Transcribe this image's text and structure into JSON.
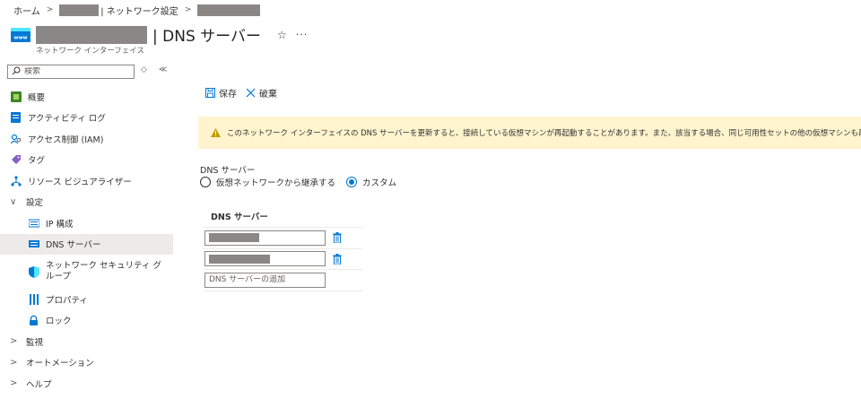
{
  "breadcrumb": {
    "home": "ホーム",
    "parent": "| ネットワーク設定"
  },
  "header": {
    "title": "| DNS サーバー",
    "subtitle": "ネットワーク インターフェイス",
    "star": "☆",
    "more": "···"
  },
  "search": {
    "placeholder": "検索"
  },
  "sidebar": {
    "collapse_icon": "≪",
    "items": [
      {
        "label": "概要",
        "icon": "overview-icon"
      },
      {
        "label": "アクティビティ ログ",
        "icon": "activity-log-icon"
      },
      {
        "label": "アクセス制御 (IAM)",
        "icon": "access-control-icon"
      },
      {
        "label": "タグ",
        "icon": "tag-icon"
      },
      {
        "label": "リソース ビジュアライザー",
        "icon": "resource-visualizer-icon"
      },
      {
        "label": "設定",
        "icon": "chevron-down-icon"
      },
      {
        "label": "IP 構成",
        "icon": "ip-config-icon"
      },
      {
        "label": "DNS サーバー",
        "icon": "dns-server-icon"
      },
      {
        "label": "ネットワーク セキュリティ グループ",
        "icon": "network-security-group-icon"
      },
      {
        "label": "プロパティ",
        "icon": "properties-icon"
      },
      {
        "label": "ロック",
        "icon": "lock-icon"
      },
      {
        "label": "監視",
        "icon": "chevron-right-icon"
      },
      {
        "label": "オートメーション",
        "icon": "chevron-right-icon"
      },
      {
        "label": "ヘルプ",
        "icon": "chevron-right-icon"
      }
    ]
  },
  "toolbar": {
    "save_label": "保存",
    "discard_label": "破棄"
  },
  "warning": {
    "text": "このネットワーク インターフェイスの DNS サーバーを更新すると、接続している仮想マシンが再起動することがあります。また、該当する場合、同じ可用性セットの他の仮想マシンも再起動することがあります。"
  },
  "dns": {
    "label": "DNS サーバー",
    "option_inherit": "仮想ネットワークから継承する",
    "option_custom": "カスタム",
    "selected": "カスタム",
    "table_header": "DNS サーバー",
    "add_placeholder": "DNS サーバーの追加"
  },
  "colors": {
    "accent": "#0078d4",
    "warning_bg": "#fff4ce",
    "warning_icon": "#c19c00",
    "selected_bg": "#edebe9"
  }
}
